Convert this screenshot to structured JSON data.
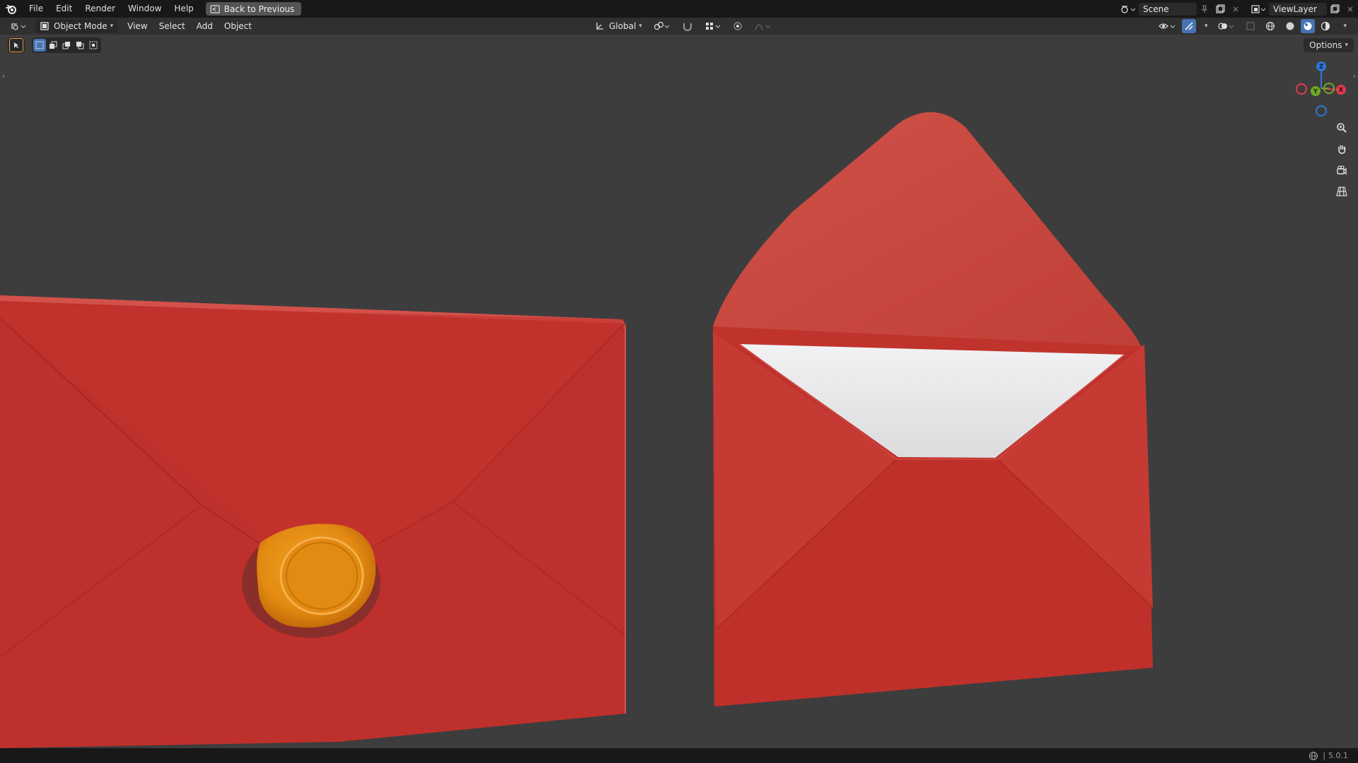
{
  "menubar": {
    "items": [
      "File",
      "Edit",
      "Render",
      "Window",
      "Help"
    ],
    "back_button": "Back to Previous",
    "scene_name": "Scene",
    "view_layer": "ViewLayer"
  },
  "header": {
    "mode": "Object Mode",
    "menus": [
      "View",
      "Select",
      "Add",
      "Object"
    ],
    "transform_orientation": "Global"
  },
  "viewport": {
    "options_label": "Options",
    "gizmo_axes": {
      "z": "Z",
      "y": "Y",
      "x": "X"
    },
    "gizmo_colors": {
      "x": "#e03a4e",
      "y": "#6fa82a",
      "z": "#2f76d6"
    },
    "objects": {
      "envelope_color": "#c0302c",
      "seal_color": "#e38a12",
      "letter_color": "#ececec"
    }
  },
  "statusbar": {
    "version": "5.0.1"
  }
}
